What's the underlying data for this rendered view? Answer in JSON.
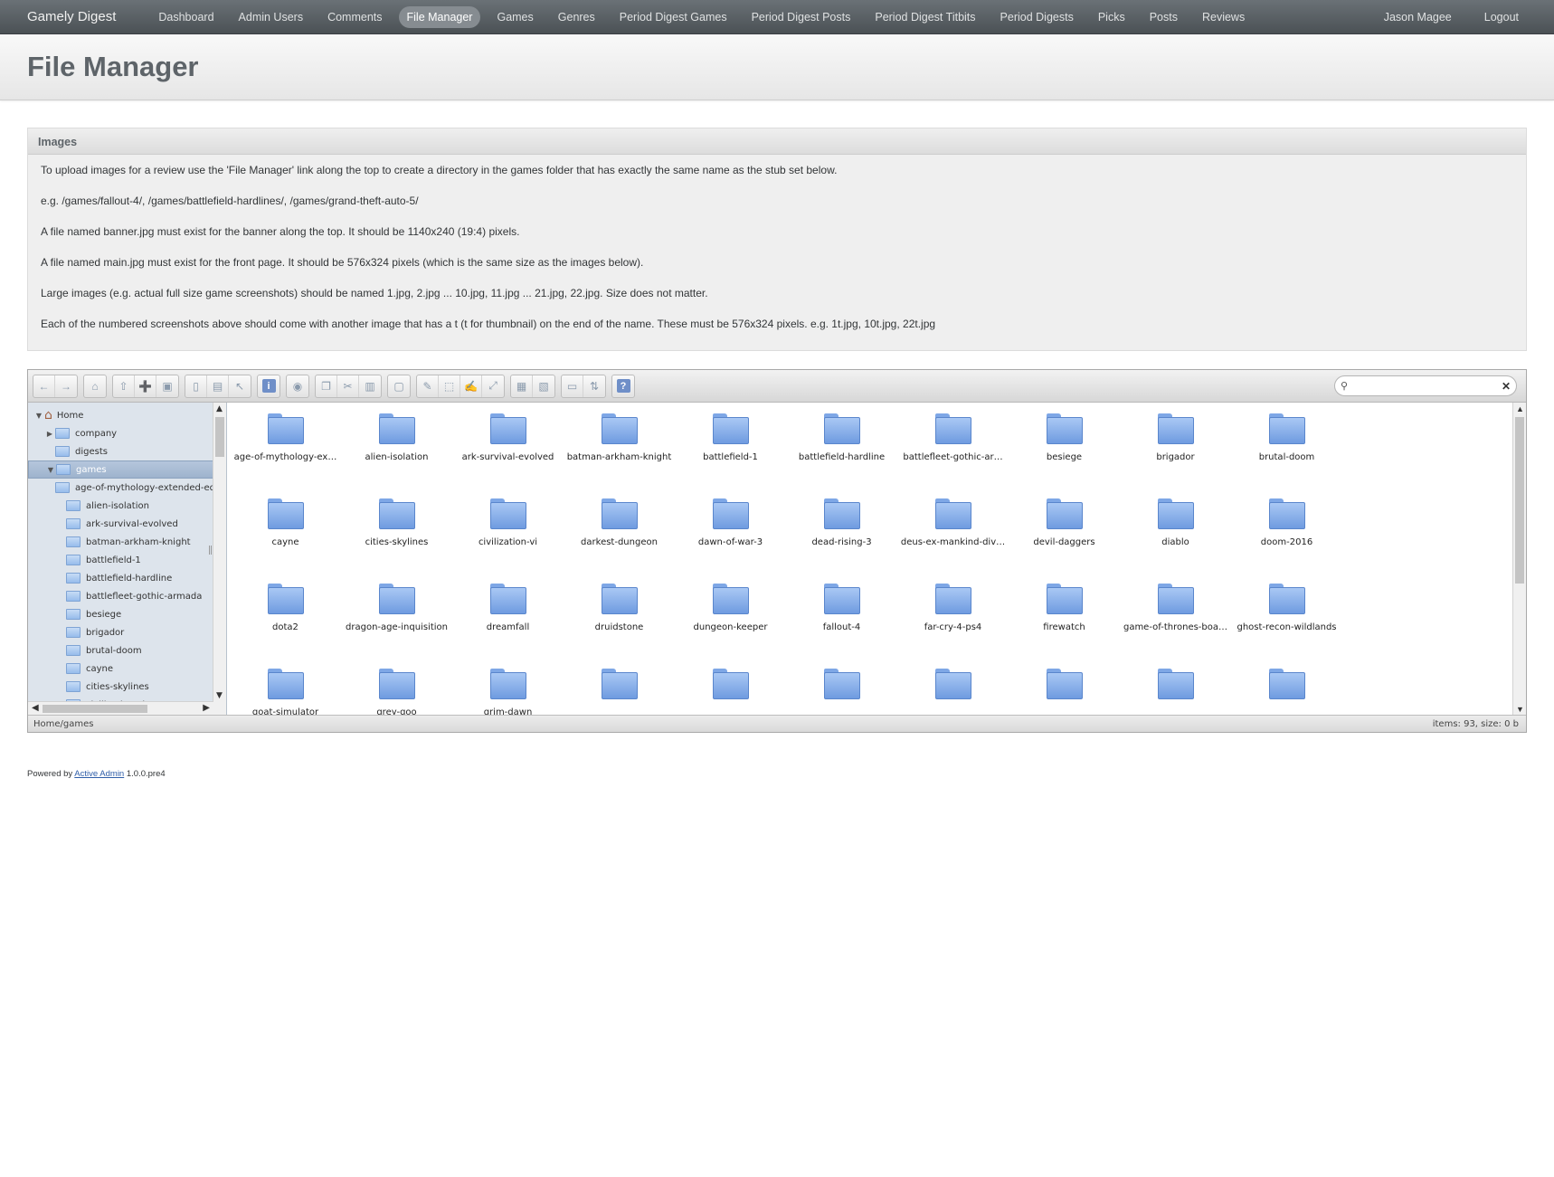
{
  "header": {
    "site_title": "Gamely Digest",
    "nav": [
      {
        "label": "Dashboard"
      },
      {
        "label": "Admin Users"
      },
      {
        "label": "Comments"
      },
      {
        "label": "File Manager"
      },
      {
        "label": "Games"
      },
      {
        "label": "Genres"
      },
      {
        "label": "Period Digest Games"
      },
      {
        "label": "Period Digest Posts"
      },
      {
        "label": "Period Digest Titbits"
      },
      {
        "label": "Period Digests"
      },
      {
        "label": "Picks"
      },
      {
        "label": "Posts"
      },
      {
        "label": "Reviews"
      }
    ],
    "current_nav": "File Manager",
    "user_name": "Jason Magee",
    "logout_label": "Logout"
  },
  "page_title": "File Manager",
  "panel": {
    "title": "Images",
    "paragraphs": [
      "To upload images for a review use the 'File Manager' link along the top to create a directory in the games folder that has exactly the same name as the stub set below.",
      "e.g. /games/fallout-4/, /games/battlefield-hardlines/, /games/grand-theft-auto-5/",
      "A file named banner.jpg must exist for the banner along the top. It should be 1140x240 (19:4) pixels.",
      "A file named main.jpg must exist for the front page. It should be 576x324 pixels (which is the same size as the images below).",
      "Large images (e.g. actual full size game screenshots) should be named 1.jpg, 2.jpg ... 10.jpg, 11.jpg ... 21.jpg, 22.jpg. Size does not matter.",
      "Each of the numbered screenshots above should come with another image that has a t (t for thumbnail) on the end of the name. These must be 576x324 pixels. e.g. 1t.jpg, 10t.jpg, 22t.jpg"
    ]
  },
  "file_manager": {
    "search": {
      "placeholder": "",
      "value": ""
    },
    "toolbar_groups": [
      [
        "back-icon",
        "forward-icon"
      ],
      [
        "home-icon"
      ],
      [
        "up-icon",
        "new-file-icon",
        "save-icon"
      ],
      [
        "open-icon",
        "download-icon",
        "select-icon"
      ],
      [
        "info-icon"
      ],
      [
        "preview-icon"
      ],
      [
        "copy-icon",
        "cut-icon",
        "paste-icon"
      ],
      [
        "duplicate-icon"
      ],
      [
        "edit-icon",
        "rename-icon",
        "write-icon",
        "resize-icon"
      ],
      [
        "extract-icon",
        "archive-icon"
      ],
      [
        "view-icon",
        "sort-icon"
      ],
      [
        "help-icon"
      ]
    ],
    "tree": {
      "root": "Home",
      "items": [
        "company",
        "digests"
      ],
      "selected": "games",
      "children": [
        "age-of-mythology-extended-ed",
        "alien-isolation",
        "ark-survival-evolved",
        "batman-arkham-knight",
        "battlefield-1",
        "battlefield-hardline",
        "battlefleet-gothic-armada",
        "besiege",
        "brigador",
        "brutal-doom",
        "cayne",
        "cities-skylines",
        "civilization-vi"
      ]
    },
    "files": [
      "age-of-mythology-ex…",
      "alien-isolation",
      "ark-survival-evolved",
      "batman-arkham-knight",
      "battlefield-1",
      "battlefield-hardline",
      "battlefleet-gothic-ar…",
      "besiege",
      "brigador",
      "brutal-doom",
      "cayne",
      "cities-skylines",
      "civilization-vi",
      "darkest-dungeon",
      "dawn-of-war-3",
      "dead-rising-3",
      "deus-ex-mankind-div…",
      "devil-daggers",
      "diablo",
      "doom-2016",
      "dota2",
      "dragon-age-inquisition",
      "dreamfall",
      "druidstone",
      "dungeon-keeper",
      "fallout-4",
      "far-cry-4-ps4",
      "firewatch",
      "game-of-thrones-boa…",
      "ghost-recon-wildlands",
      "goat-simulator",
      "grey-goo",
      "grim-dawn",
      "",
      "",
      "",
      "",
      "",
      "",
      "",
      "",
      "",
      "",
      ""
    ],
    "status_path": "Home/games",
    "status_info": "items: 93, size: 0 b"
  },
  "footer": {
    "prefix": "Powered by",
    "link": "Active Admin",
    "version": "1.0.0.pre4"
  }
}
